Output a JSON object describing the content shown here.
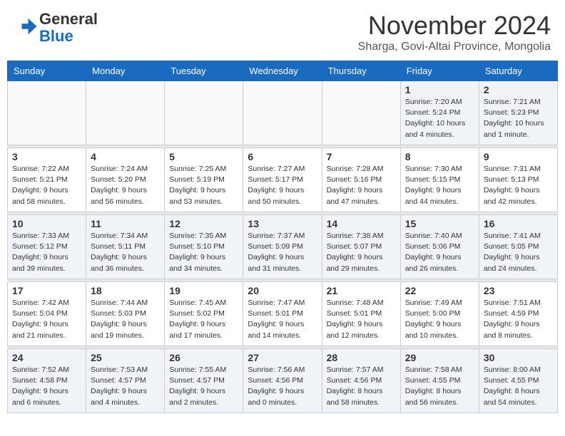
{
  "title": "November 2024",
  "subtitle": "Sharga, Govi-Altai Province, Mongolia",
  "logo": {
    "line1": "General",
    "line2": "Blue"
  },
  "days_of_week": [
    "Sunday",
    "Monday",
    "Tuesday",
    "Wednesday",
    "Thursday",
    "Friday",
    "Saturday"
  ],
  "weeks": [
    [
      {
        "day": "",
        "info": "",
        "empty": true
      },
      {
        "day": "",
        "info": "",
        "empty": true
      },
      {
        "day": "",
        "info": "",
        "empty": true
      },
      {
        "day": "",
        "info": "",
        "empty": true
      },
      {
        "day": "",
        "info": "",
        "empty": true
      },
      {
        "day": "1",
        "info": "Sunrise: 7:20 AM\nSunset: 5:24 PM\nDaylight: 10 hours\nand 4 minutes.",
        "empty": false
      },
      {
        "day": "2",
        "info": "Sunrise: 7:21 AM\nSunset: 5:23 PM\nDaylight: 10 hours\nand 1 minute.",
        "empty": false
      }
    ],
    [
      {
        "day": "3",
        "info": "Sunrise: 7:22 AM\nSunset: 5:21 PM\nDaylight: 9 hours\nand 58 minutes.",
        "empty": false
      },
      {
        "day": "4",
        "info": "Sunrise: 7:24 AM\nSunset: 5:20 PM\nDaylight: 9 hours\nand 56 minutes.",
        "empty": false
      },
      {
        "day": "5",
        "info": "Sunrise: 7:25 AM\nSunset: 5:19 PM\nDaylight: 9 hours\nand 53 minutes.",
        "empty": false
      },
      {
        "day": "6",
        "info": "Sunrise: 7:27 AM\nSunset: 5:17 PM\nDaylight: 9 hours\nand 50 minutes.",
        "empty": false
      },
      {
        "day": "7",
        "info": "Sunrise: 7:28 AM\nSunset: 5:16 PM\nDaylight: 9 hours\nand 47 minutes.",
        "empty": false
      },
      {
        "day": "8",
        "info": "Sunrise: 7:30 AM\nSunset: 5:15 PM\nDaylight: 9 hours\nand 44 minutes.",
        "empty": false
      },
      {
        "day": "9",
        "info": "Sunrise: 7:31 AM\nSunset: 5:13 PM\nDaylight: 9 hours\nand 42 minutes.",
        "empty": false
      }
    ],
    [
      {
        "day": "10",
        "info": "Sunrise: 7:33 AM\nSunset: 5:12 PM\nDaylight: 9 hours\nand 39 minutes.",
        "empty": false
      },
      {
        "day": "11",
        "info": "Sunrise: 7:34 AM\nSunset: 5:11 PM\nDaylight: 9 hours\nand 36 minutes.",
        "empty": false
      },
      {
        "day": "12",
        "info": "Sunrise: 7:35 AM\nSunset: 5:10 PM\nDaylight: 9 hours\nand 34 minutes.",
        "empty": false
      },
      {
        "day": "13",
        "info": "Sunrise: 7:37 AM\nSunset: 5:09 PM\nDaylight: 9 hours\nand 31 minutes.",
        "empty": false
      },
      {
        "day": "14",
        "info": "Sunrise: 7:38 AM\nSunset: 5:07 PM\nDaylight: 9 hours\nand 29 minutes.",
        "empty": false
      },
      {
        "day": "15",
        "info": "Sunrise: 7:40 AM\nSunset: 5:06 PM\nDaylight: 9 hours\nand 26 minutes.",
        "empty": false
      },
      {
        "day": "16",
        "info": "Sunrise: 7:41 AM\nSunset: 5:05 PM\nDaylight: 9 hours\nand 24 minutes.",
        "empty": false
      }
    ],
    [
      {
        "day": "17",
        "info": "Sunrise: 7:42 AM\nSunset: 5:04 PM\nDaylight: 9 hours\nand 21 minutes.",
        "empty": false
      },
      {
        "day": "18",
        "info": "Sunrise: 7:44 AM\nSunset: 5:03 PM\nDaylight: 9 hours\nand 19 minutes.",
        "empty": false
      },
      {
        "day": "19",
        "info": "Sunrise: 7:45 AM\nSunset: 5:02 PM\nDaylight: 9 hours\nand 17 minutes.",
        "empty": false
      },
      {
        "day": "20",
        "info": "Sunrise: 7:47 AM\nSunset: 5:01 PM\nDaylight: 9 hours\nand 14 minutes.",
        "empty": false
      },
      {
        "day": "21",
        "info": "Sunrise: 7:48 AM\nSunset: 5:01 PM\nDaylight: 9 hours\nand 12 minutes.",
        "empty": false
      },
      {
        "day": "22",
        "info": "Sunrise: 7:49 AM\nSunset: 5:00 PM\nDaylight: 9 hours\nand 10 minutes.",
        "empty": false
      },
      {
        "day": "23",
        "info": "Sunrise: 7:51 AM\nSunset: 4:59 PM\nDaylight: 9 hours\nand 8 minutes.",
        "empty": false
      }
    ],
    [
      {
        "day": "24",
        "info": "Sunrise: 7:52 AM\nSunset: 4:58 PM\nDaylight: 9 hours\nand 6 minutes.",
        "empty": false
      },
      {
        "day": "25",
        "info": "Sunrise: 7:53 AM\nSunset: 4:57 PM\nDaylight: 9 hours\nand 4 minutes.",
        "empty": false
      },
      {
        "day": "26",
        "info": "Sunrise: 7:55 AM\nSunset: 4:57 PM\nDaylight: 9 hours\nand 2 minutes.",
        "empty": false
      },
      {
        "day": "27",
        "info": "Sunrise: 7:56 AM\nSunset: 4:56 PM\nDaylight: 9 hours\nand 0 minutes.",
        "empty": false
      },
      {
        "day": "28",
        "info": "Sunrise: 7:57 AM\nSunset: 4:56 PM\nDaylight: 8 hours\nand 58 minutes.",
        "empty": false
      },
      {
        "day": "29",
        "info": "Sunrise: 7:58 AM\nSunset: 4:55 PM\nDaylight: 8 hours\nand 56 minutes.",
        "empty": false
      },
      {
        "day": "30",
        "info": "Sunrise: 8:00 AM\nSunset: 4:55 PM\nDaylight: 8 hours\nand 54 minutes.",
        "empty": false
      }
    ]
  ]
}
